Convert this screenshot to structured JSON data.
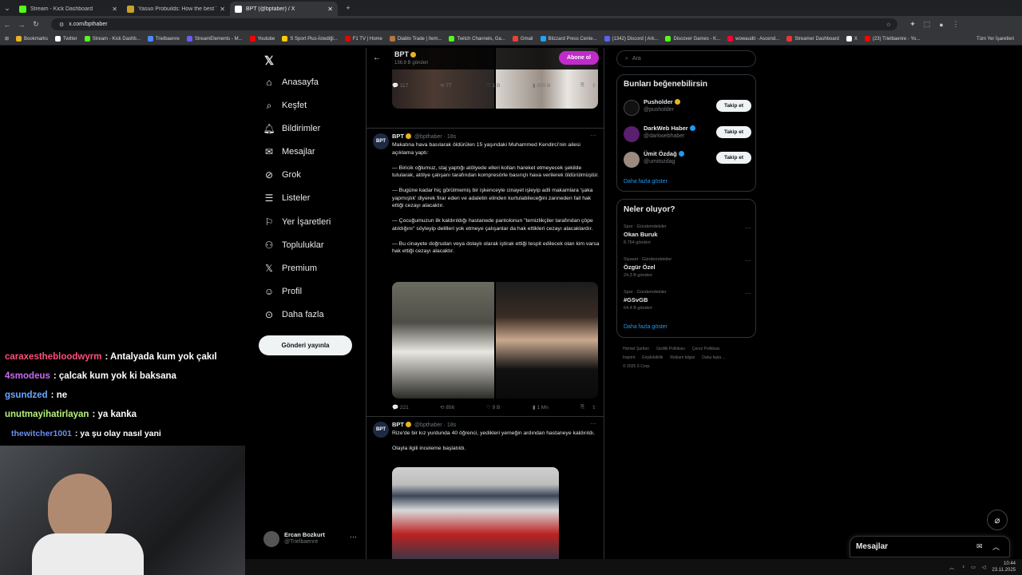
{
  "browser": {
    "tabs": [
      {
        "title": "Stream - Kick Dashboard",
        "color": "#53fc18"
      },
      {
        "title": "Yasuo Probuilds: How the best Y",
        "color": "#c9a227"
      },
      {
        "title": "BPT (@bptaber) / X",
        "color": "#ffffff"
      }
    ],
    "url": "x.com/bpthaber",
    "bookmarks": [
      "Bookmarks",
      "Twitter",
      "Stream - Kick Dashb...",
      "Trielbaenre",
      "StreamElements - M...",
      "Youtube",
      "S Sport Plus-İstediği...",
      "F1 TV | Home",
      "Diablo Trade | Item...",
      "Twitch Channels, Ga...",
      "Gmail",
      "Blizzard Press Cente...",
      "(1342) Discord | Ark...",
      "Discover Games - K...",
      "wowaudit - Ascend...",
      "Streamer Dashboard",
      "X",
      "(23) Trielbaenre - Yo..."
    ],
    "bookmarks_right": "Tüm Yer İşaretleri"
  },
  "nav": {
    "items": [
      "Anasayfa",
      "Keşfet",
      "Bildirimler",
      "Mesajlar",
      "Grok",
      "Listeler",
      "Yer İşaretleri",
      "Topluluklar",
      "Premium",
      "Profil",
      "Daha fazla"
    ],
    "post_button": "Gönderi yayınla",
    "account_name": "Ercan Bozkurt",
    "account_handle": "@Trielbaenre"
  },
  "profile_header": {
    "name": "BPT",
    "post_count": "136,8 B gönderi",
    "subscribe": "Abone ol"
  },
  "tweets": [
    {
      "replies": "117",
      "retweets": "77",
      "likes": "1 B",
      "views": "899 B"
    },
    {
      "name": "BPT",
      "handle": "@bpthaber",
      "time": "· 18s",
      "avatar": "BPT",
      "text": [
        "Makatına hava basılarak öldürülen 15 yaşındaki Muhammed Kendirci'nin ailesi açıklama yaptı:",
        "— Biricik oğlumuz, staj yaptığı atölyede elleri kolları hareket etmeyecek şekilde tutularak, atölye çalışanı tarafından kompresörle basınçlı hava verilerek öldürülmüştür.",
        "— Bugüne kadar hiç görülmemiş bir işkenceyle cinayet işleyip adli makamlara 'şaka yapmıştık' diyerek firar eden ve adaletin elinden kurtulabileceğini zanneden fail hak ettiği cezayı alacaktır.",
        "— Çocuğumuzun ilk kaldırıldığı hastanede pantolonun \"temizlikçiler tarafından çöpe atıldığını\" söyleyip delilleri yok etmeye çalışanlar da hak ettikleri cezayı alacaklardır.",
        "— Bu cinayete doğrudan veya dolaylı olarak iştirak ettiği tespit edilecek olan kim varsa hak ettiği cezayı alacaktır."
      ],
      "replies": "221",
      "retweets": "856",
      "likes": "9 B",
      "views": "1 Mn"
    },
    {
      "name": "BPT",
      "handle": "@bpthaber",
      "time": "· 18s",
      "avatar": "BPT",
      "text": [
        "Rize'de bir kız yurdunda 40 öğrenci, yedikleri yemeğin ardından hastaneye kaldırıldı.",
        "Olayla ilgili inceleme başlatıldı."
      ]
    }
  ],
  "right": {
    "search_placeholder": "Ara",
    "suggest_title": "Bunları beğenebilirsin",
    "suggestions": [
      {
        "name": "Pusholder",
        "handle": "@pusholder",
        "follow": "Takip et"
      },
      {
        "name": "DarkWeb Haber",
        "handle": "@darkwebhaber",
        "follow": "Takip et"
      },
      {
        "name": "Ümit Özdağ",
        "handle": "@umitozdag",
        "follow": "Takip et"
      }
    ],
    "show_more": "Daha fazla göster",
    "trends_title": "Neler oluyor?",
    "trends": [
      {
        "category": "Spor · Gündemdekiler",
        "topic": "Okan Buruk",
        "count": "8.764 gönderi"
      },
      {
        "category": "Siyaset · Gündemdekiler",
        "topic": "Özgür Özel",
        "count": "24,3 B gönderi"
      },
      {
        "category": "Spor · Gündemdekiler",
        "topic": "#GSvGB",
        "count": "64,4 B gönderi"
      }
    ],
    "trends_more": "Daha fazla göster",
    "footer": [
      "Hizmet Şartları",
      "Gizlilik Politikası",
      "Çerez Politikası",
      "İmprint",
      "Erişilebilirlik",
      "Reklam bilgisi",
      "Daha fazla ...",
      "© 2025 X Corp."
    ]
  },
  "chat": [
    {
      "user": "caraxesthebloodwyrm",
      "msg": ": Antalyada kum yok çakıl",
      "color": "#ff4f7a"
    },
    {
      "user": "4smodeus",
      "msg": ": çalcak kum yok ki baksana",
      "color": "#c86cf0"
    },
    {
      "user": "gsundzed",
      "msg": ": ne",
      "color": "#6aa7ff"
    },
    {
      "user": "unutmayihatirlayan",
      "msg": ": ya kanka",
      "color": "#b8f27c"
    },
    {
      "user": "thewitcher1001",
      "msg": ": ya şu olay nasıl yani",
      "color": "#6c8ff0"
    }
  ],
  "messages_bar": {
    "label": "Mesajlar"
  },
  "taskbar": {
    "time": "10:44",
    "date": "23.11.2025"
  }
}
